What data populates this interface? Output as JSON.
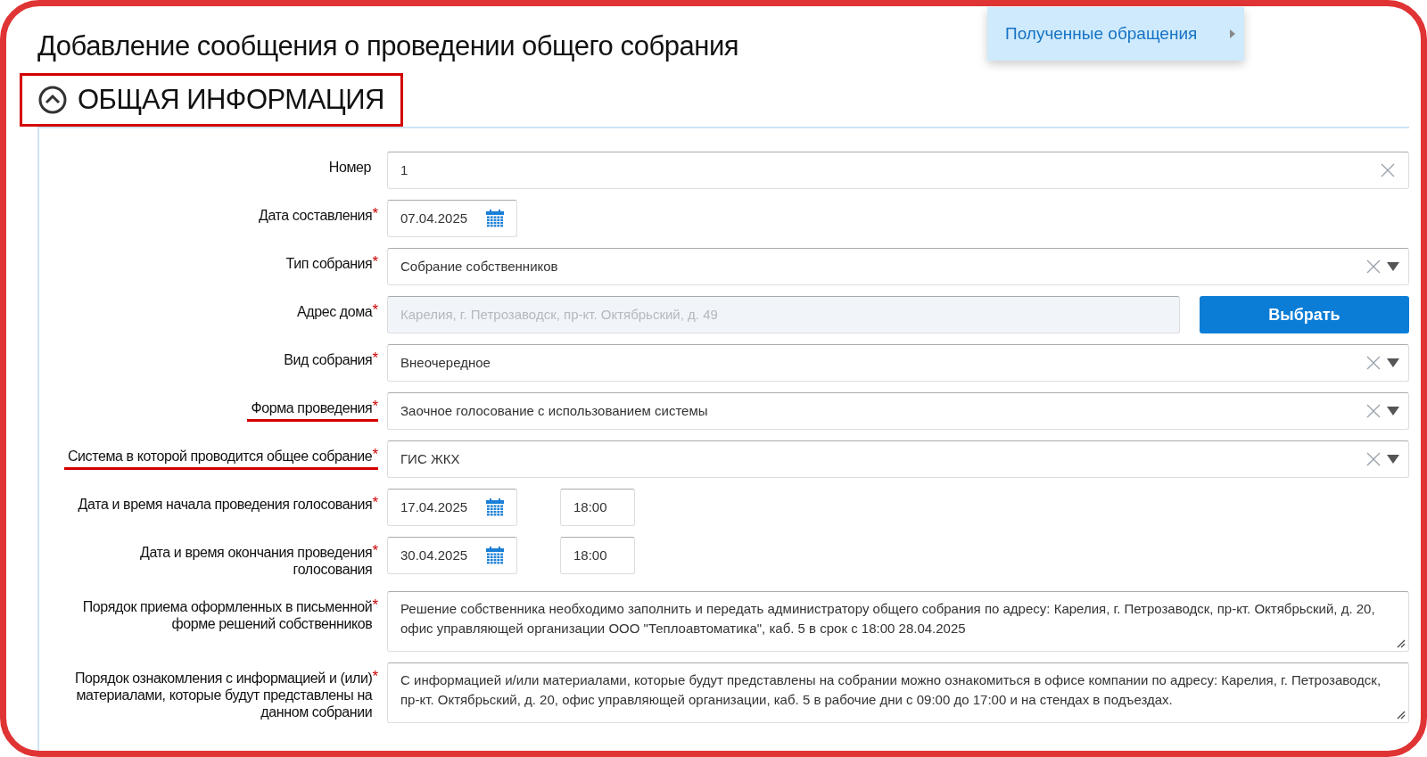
{
  "title": "Добавление сообщения о проведении общего собрания",
  "section": {
    "title": "ОБЩАЯ ИНФОРМАЦИЯ",
    "expanded": true,
    "highlighted": true
  },
  "popup_menu": {
    "item": "Полученные обращения"
  },
  "fields": [
    {
      "kind": "text",
      "label": "Номер",
      "underlined": false,
      "value": "1"
    },
    {
      "kind": "date",
      "label": "Дата составления",
      "required_mark": "*",
      "underlined": false,
      "value": "07.04.2025"
    },
    {
      "kind": "select",
      "label": "Тип собрания",
      "required_mark": "*",
      "underlined": false,
      "value": "Собрание собственников"
    },
    {
      "kind": "address",
      "label": "Адрес дома",
      "required_mark": "*",
      "underlined": false,
      "placeholder": "Карелия, г. Петрозаводск, пр-кт. Октябрьский, д. 49",
      "button": "Выбрать"
    },
    {
      "kind": "select",
      "label": "Вид собрания",
      "required_mark": "*",
      "underlined": false,
      "value": "Внеочередное"
    },
    {
      "kind": "select",
      "label": "Форма проведения",
      "required_mark": "*",
      "underlined": true,
      "value": "Заочное голосование с использованием системы"
    },
    {
      "kind": "select",
      "label": "Система в которой проводится общее собрание",
      "required_mark": "*",
      "underlined": true,
      "value": "ГИС ЖКХ"
    },
    {
      "kind": "datetime",
      "label": "Дата и время начала проведения голосования",
      "required_mark": "*",
      "underlined": false,
      "value": "17.04.2025",
      "time": "18:00"
    },
    {
      "kind": "datetime",
      "label": "Дата и время окончания проведения голосования",
      "required_mark": "*",
      "underlined": false,
      "value": "30.04.2025",
      "time": "18:00"
    },
    {
      "kind": "textarea",
      "label": "Порядок приема оформленных в письменной форме решений собственников",
      "required_mark": "*",
      "underlined": false,
      "value": "Решение собственника необходимо заполнить и передать администратору общего собрания по адресу: Карелия, г. Петрозаводск, пр-кт. Октябрьский, д. 20, офис управляющей организации ООО \"Теплоавтоматика\", каб. 5 в срок с 18:00 28.04.2025"
    },
    {
      "kind": "textarea",
      "label": "Порядок ознакомления с информацией и (или) материалами, которые будут представлены на данном собрании",
      "required_mark": "*",
      "underlined": false,
      "value": "С информацией и/или материалами, которые будут представлены на собрании можно ознакомиться в офисе компании по адресу: Карелия, г. Петрозаводск, пр-кт. Октябрьский, д. 20, офис управляющей организации, каб. 5 в рабочие дни с 09:00 до 17:00 и на стендах в подъездах."
    }
  ]
}
